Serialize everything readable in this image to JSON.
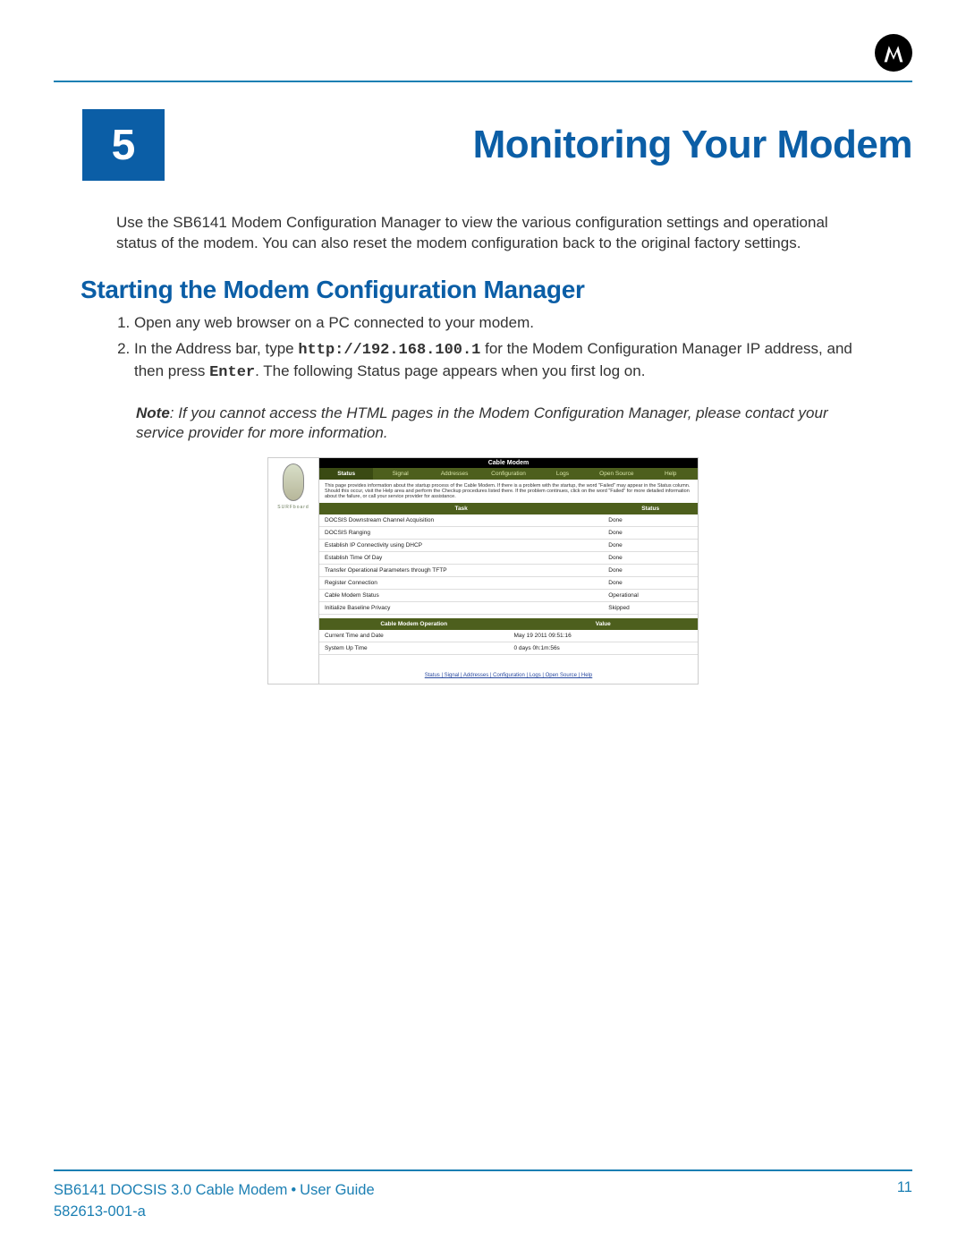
{
  "chapter": {
    "number": "5",
    "title": "Monitoring Your Modem"
  },
  "intro": "Use the SB6141 Modem Configuration Manager to view the various configuration settings and operational status of the modem. You can also reset the modem configuration back to the original factory settings.",
  "section1": {
    "heading": "Starting the Modem Configuration Manager",
    "step1": "Open any web browser on a PC connected to your modem.",
    "step2a": "In the Address bar, type ",
    "step2_url": "http://192.168.100.1",
    "step2b": " for the Modem Configuration Manager IP address, and then press ",
    "step2_key": "Enter",
    "step2c": ". The following Status page appears when you first log on.",
    "note_label": "Note",
    "note_body": ": If you cannot access the HTML pages in the Modem Configuration Manager, please contact your service provider for more information."
  },
  "modem_ui": {
    "brand": "SURFboard",
    "title": "Cable Modem",
    "tabs": [
      "Status",
      "Signal",
      "Addresses",
      "Configuration",
      "Logs",
      "Open Source",
      "Help"
    ],
    "info": "This page provides information about the startup process of the Cable Modem. If there is a problem with the startup, the word \"Failed\" may appear in the Status column. Should this occur, visit the Help area and perform the Checkup procedures listed there. If the problem continues, click on the word \"Failed\" for more detailed information about the failure, or call your service provider for assistance.",
    "task_header": "Task",
    "status_header": "Status",
    "tasks": [
      {
        "t": "DOCSIS Downstream Channel Acquisition",
        "s": "Done"
      },
      {
        "t": "DOCSIS Ranging",
        "s": "Done"
      },
      {
        "t": "Establish IP Connectivity using DHCP",
        "s": "Done"
      },
      {
        "t": "Establish Time Of Day",
        "s": "Done"
      },
      {
        "t": "Transfer Operational Parameters through TFTP",
        "s": "Done"
      },
      {
        "t": "Register Connection",
        "s": "Done"
      },
      {
        "t": "Cable Modem Status",
        "s": "Operational"
      },
      {
        "t": "Initialize Baseline Privacy",
        "s": "Skipped"
      }
    ],
    "op_header": "Cable Modem Operation",
    "val_header": "Value",
    "ops": [
      {
        "t": "Current Time and Date",
        "s": "May 19 2011 09:51:16"
      },
      {
        "t": "System Up Time",
        "s": "0 days 0h:1m:56s"
      }
    ],
    "bottom_links": "Status | Signal | Addresses | Configuration | Logs | Open Source | Help"
  },
  "footer": {
    "doc_title": "SB6141 DOCSIS 3.0 Cable Modem",
    "doc_section": "User Guide",
    "doc_num": "582613-001-a",
    "page": "11"
  }
}
